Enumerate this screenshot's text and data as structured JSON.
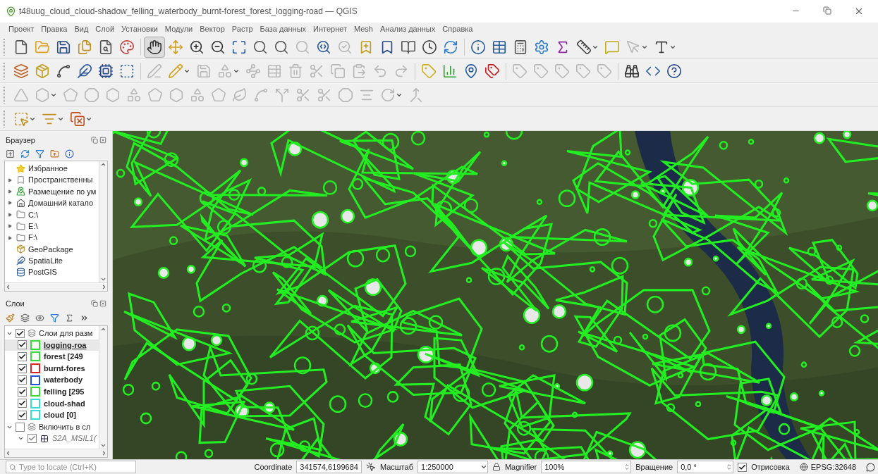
{
  "window": {
    "title": "t48uug_cloud_cloud-shadow_felling_waterbody_burnt-forest_forest_logging-road — QGIS"
  },
  "menu": [
    "Проект",
    "Правка",
    "Вид",
    "Слой",
    "Установки",
    "Модули",
    "Вектор",
    "Растр",
    "База данных",
    "Интернет",
    "Mesh",
    "Анализ данных",
    "Справка"
  ],
  "toolbars": [
    {
      "buttons": [
        {
          "disabled": false,
          "selected": false
        },
        {
          "disabled": false,
          "selected": false
        },
        {
          "disabled": false,
          "selected": false
        },
        {
          "disabled": false,
          "selected": false
        },
        {
          "disabled": false,
          "selected": false
        },
        {
          "disabled": false,
          "selected": false
        },
        {
          "disabled": false,
          "selected": true
        },
        {
          "disabled": false,
          "selected": false
        },
        {
          "disabled": false,
          "selected": false
        },
        {
          "disabled": false,
          "selected": false
        },
        {
          "disabled": false,
          "selected": false
        },
        {
          "disabled": false,
          "selected": false
        },
        {
          "disabled": false,
          "selected": false
        },
        {
          "disabled": true,
          "selected": false
        },
        {
          "disabled": false,
          "selected": false
        },
        {
          "disabled": true,
          "selected": false
        },
        {
          "disabled": false,
          "selected": false
        },
        {
          "disabled": false,
          "selected": false
        },
        {
          "disabled": false,
          "selected": false
        },
        {
          "disabled": false,
          "selected": false
        },
        {
          "disabled": false,
          "selected": false
        },
        {
          "disabled": false,
          "selected": false
        },
        {
          "disabled": false,
          "selected": false
        },
        {
          "disabled": false,
          "selected": false
        },
        {
          "disabled": false,
          "selected": false
        },
        {
          "disabled": false,
          "selected": false
        },
        {
          "disabled": false,
          "selected": false
        },
        {
          "disabled": false,
          "selected": false
        },
        {
          "disabled": true,
          "selected": false
        },
        {
          "disabled": false,
          "selected": false
        }
      ]
    },
    {
      "buttons": [
        {
          "disabled": false,
          "selected": false
        },
        {
          "disabled": false,
          "selected": false
        },
        {
          "disabled": false,
          "selected": false
        },
        {
          "disabled": false,
          "selected": false
        },
        {
          "disabled": false,
          "selected": false
        },
        {
          "disabled": false,
          "selected": false
        },
        {
          "disabled": true,
          "selected": false
        },
        {
          "disabled": false,
          "selected": false
        },
        {
          "disabled": true,
          "selected": false
        },
        {
          "disabled": true,
          "selected": false
        },
        {
          "disabled": true,
          "selected": false
        },
        {
          "disabled": true,
          "selected": false
        },
        {
          "disabled": true,
          "selected": false
        },
        {
          "disabled": true,
          "selected": false
        },
        {
          "disabled": true,
          "selected": false
        },
        {
          "disabled": true,
          "selected": false
        },
        {
          "disabled": true,
          "selected": false
        },
        {
          "disabled": true,
          "selected": false
        },
        {
          "disabled": false,
          "selected": false
        },
        {
          "disabled": false,
          "selected": false
        },
        {
          "disabled": false,
          "selected": false
        },
        {
          "disabled": false,
          "selected": false
        },
        {
          "disabled": true,
          "selected": false
        },
        {
          "disabled": true,
          "selected": false
        },
        {
          "disabled": true,
          "selected": false
        },
        {
          "disabled": true,
          "selected": false
        },
        {
          "disabled": true,
          "selected": false
        },
        {
          "disabled": false,
          "selected": false
        },
        {
          "disabled": false,
          "selected": false
        },
        {
          "disabled": false,
          "selected": false
        }
      ]
    },
    {
      "buttons": [
        {
          "disabled": true,
          "selected": false
        },
        {
          "disabled": true,
          "selected": false
        },
        {
          "disabled": true,
          "selected": false
        },
        {
          "disabled": true,
          "selected": false
        },
        {
          "disabled": true,
          "selected": false
        },
        {
          "disabled": true,
          "selected": false
        },
        {
          "disabled": true,
          "selected": false
        },
        {
          "disabled": true,
          "selected": false
        },
        {
          "disabled": true,
          "selected": false
        },
        {
          "disabled": true,
          "selected": false
        },
        {
          "disabled": true,
          "selected": false
        },
        {
          "disabled": true,
          "selected": false
        },
        {
          "disabled": true,
          "selected": false
        },
        {
          "disabled": true,
          "selected": false
        },
        {
          "disabled": true,
          "selected": false
        },
        {
          "disabled": true,
          "selected": false
        },
        {
          "disabled": true,
          "selected": false
        },
        {
          "disabled": true,
          "selected": false
        },
        {
          "disabled": true,
          "selected": false
        }
      ]
    },
    {
      "buttons": [
        {
          "disabled": false,
          "selected": false
        },
        {
          "disabled": false,
          "selected": false
        },
        {
          "disabled": false,
          "selected": false
        }
      ]
    }
  ],
  "browser": {
    "title": "Браузер",
    "items": [
      {
        "label": "Избранное",
        "kind": "star",
        "expandable": false
      },
      {
        "label": "Пространственны",
        "kind": "bookmark",
        "expandable": true
      },
      {
        "label": "Размещение по ум",
        "kind": "project",
        "expandable": true
      },
      {
        "label": "Домашний катало",
        "kind": "home",
        "expandable": true
      },
      {
        "label": "C:\\",
        "kind": "folder",
        "expandable": true
      },
      {
        "label": "E:\\",
        "kind": "folder",
        "expandable": true
      },
      {
        "label": "F:\\",
        "kind": "folder",
        "expandable": true
      },
      {
        "label": "GeoPackage",
        "kind": "geopackage",
        "expandable": false
      },
      {
        "label": "SpatiaLite",
        "kind": "feather",
        "expandable": false
      },
      {
        "label": "PostGIS",
        "kind": "elephant",
        "expandable": false
      }
    ]
  },
  "layers": {
    "title": "Слои",
    "groups": [
      {
        "label": "Слои для разм",
        "checked": true,
        "expanded": true,
        "children": [
          {
            "label": "logging-roa",
            "checked": true,
            "selected": true,
            "color": "#33dd33",
            "kind": "vector"
          },
          {
            "label": "forest [249",
            "checked": true,
            "selected": false,
            "color": "#33dd33",
            "kind": "vector"
          },
          {
            "label": "burnt-fores",
            "checked": true,
            "selected": false,
            "color": "#dd2222",
            "kind": "vector"
          },
          {
            "label": "waterbody",
            "checked": true,
            "selected": false,
            "color": "#2255dd",
            "kind": "vector"
          },
          {
            "label": "felling [295",
            "checked": true,
            "selected": false,
            "color": "#33dd33",
            "kind": "vector"
          },
          {
            "label": "cloud-shad",
            "checked": true,
            "selected": false,
            "color": "#33dddd",
            "kind": "vector"
          },
          {
            "label": "cloud [0]",
            "checked": true,
            "selected": false,
            "color": "#33dddd",
            "kind": "vector"
          }
        ]
      },
      {
        "label": "Включить в сл",
        "checked": false,
        "expanded": true,
        "children": [
          {
            "label": "S2A_MSIL1(",
            "checked": true,
            "selected": false,
            "kind": "raster"
          }
        ]
      }
    ]
  },
  "status_bar": {
    "locate": {
      "placeholder": "Type to locate (Ctrl+K)"
    },
    "coordinate_label": "Coordinate",
    "coordinate": "341574,6199684",
    "scale_label": "Масштаб",
    "scale": "1:250000",
    "magnifier_label": "Magnifier",
    "magnifier": "100%",
    "rotation_label": "Вращение",
    "rotation": "0,0 °",
    "render": {
      "label": "Отрисовка",
      "checked": true
    },
    "crs": "EPSG:32648"
  }
}
